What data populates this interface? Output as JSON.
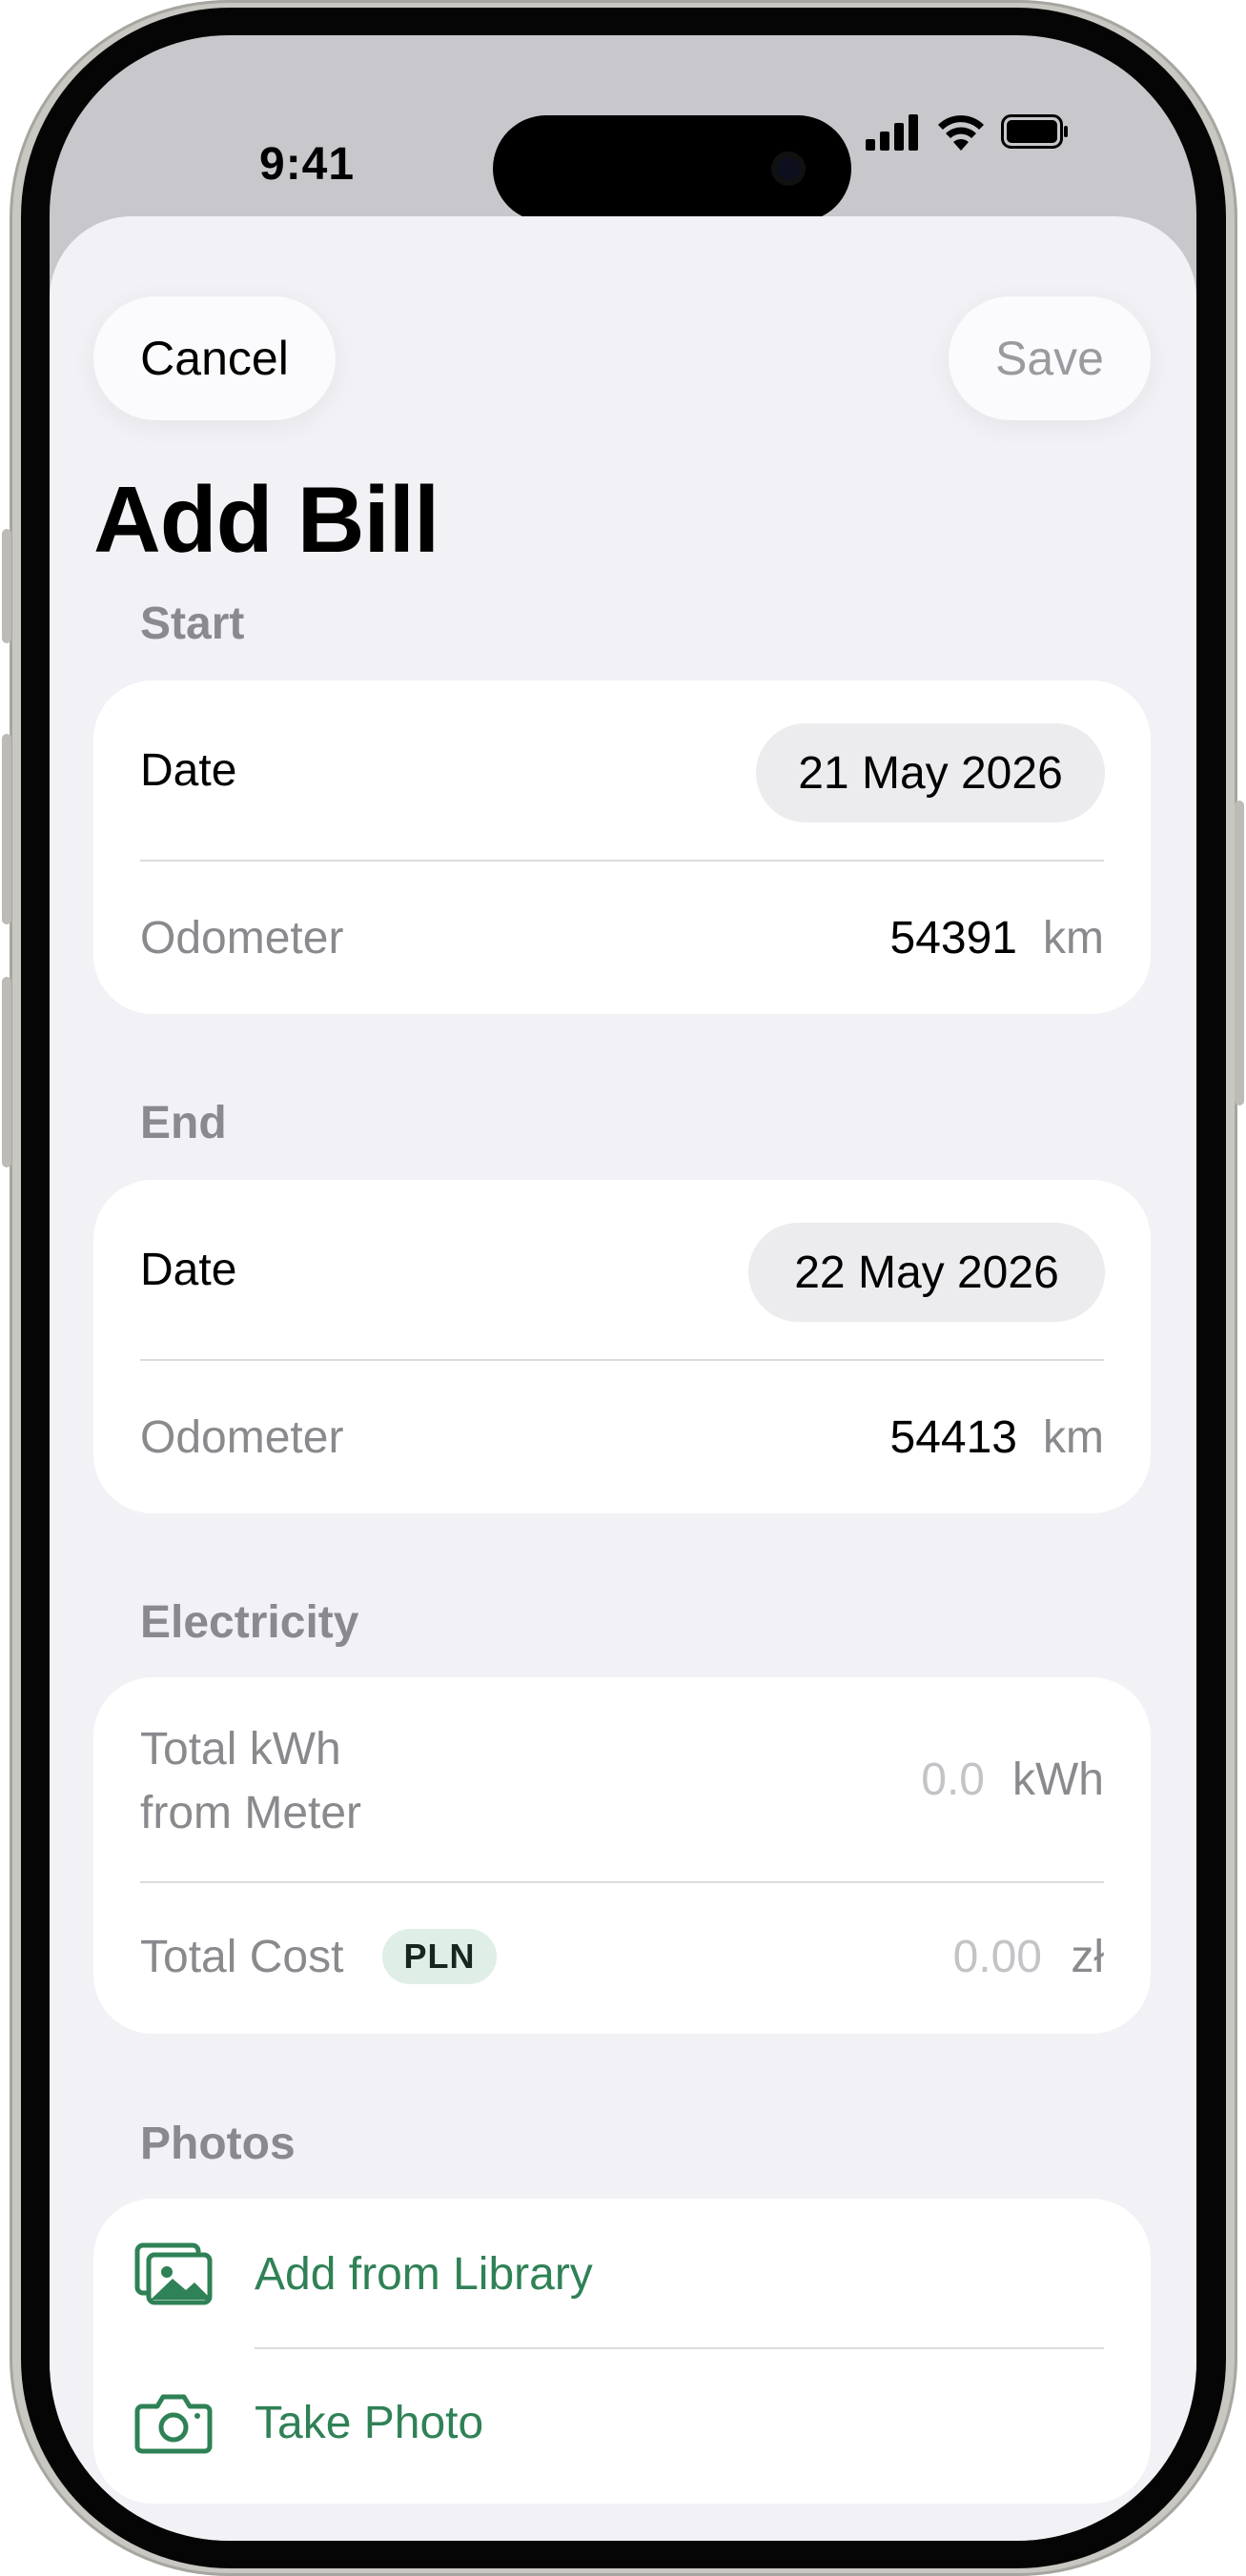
{
  "status_bar": {
    "time": "9:41"
  },
  "nav": {
    "cancel_label": "Cancel",
    "save_label": "Save"
  },
  "page_title": "Add Bill",
  "start": {
    "header": "Start",
    "date_label": "Date",
    "date_value": "21 May 2026",
    "odometer_label": "Odometer",
    "odometer_value": "54391",
    "odometer_unit": "km"
  },
  "end": {
    "header": "End",
    "date_label": "Date",
    "date_value": "22 May 2026",
    "odometer_label": "Odometer",
    "odometer_value": "54413",
    "odometer_unit": "km"
  },
  "electricity": {
    "header": "Electricity",
    "kwh_label_line1": "Total kWh",
    "kwh_label_line2": "from Meter",
    "kwh_placeholder": "0.0",
    "kwh_unit": "kWh",
    "cost_label": "Total Cost",
    "currency_badge": "PLN",
    "cost_placeholder": "0.00",
    "cost_unit": "zł"
  },
  "photos": {
    "header": "Photos",
    "add_from_library_label": "Add from Library",
    "take_photo_label": "Take Photo"
  },
  "colors": {
    "accent_green": "#2f8156",
    "sheet_background": "#f2f2f6",
    "secondary_text": "#8a8a8e"
  },
  "icons": {
    "library": "photo-library-icon",
    "camera": "camera-icon",
    "signal": "cellular-signal-icon",
    "wifi": "wifi-icon",
    "battery": "battery-icon"
  }
}
